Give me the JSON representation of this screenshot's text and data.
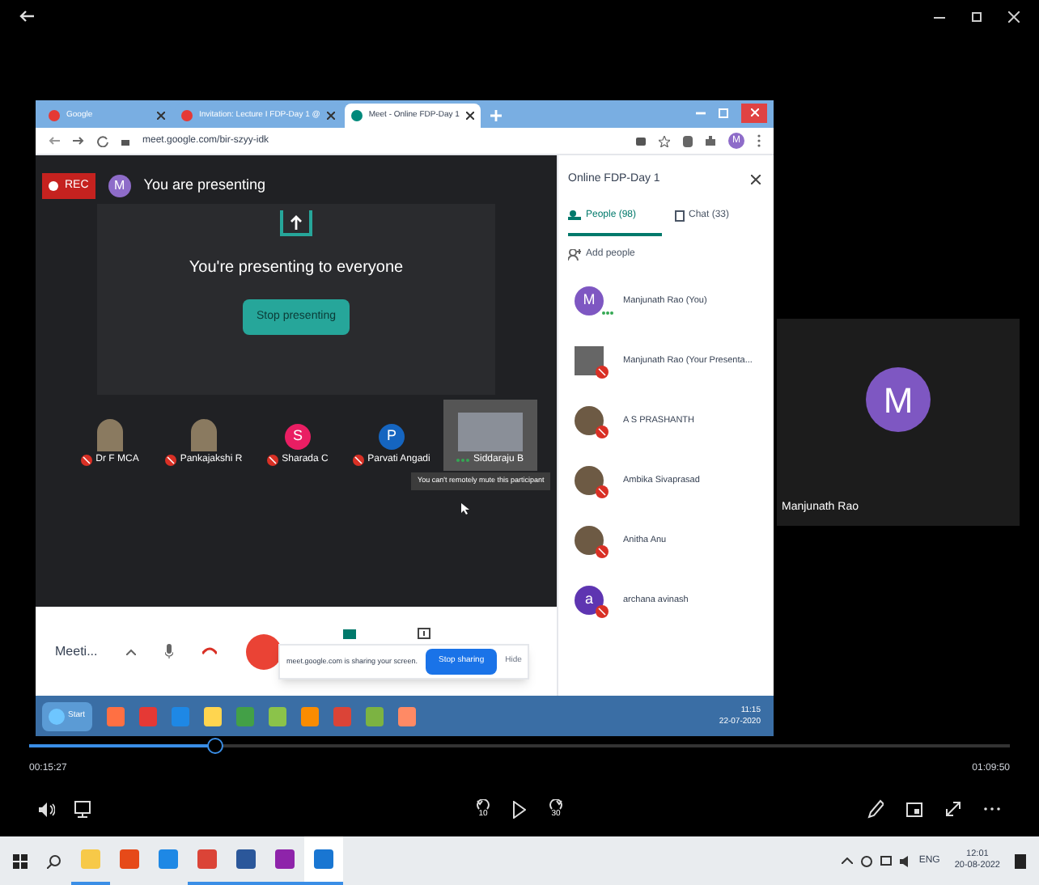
{
  "browser": {
    "tabs": [
      {
        "title": "Google",
        "selected": false
      },
      {
        "title": "Invitation: Lecture I FDP-Day 1 @",
        "selected": false
      },
      {
        "title": "Meet - Online FDP-Day 1",
        "selected": true
      }
    ],
    "url": "meet.google.com/bir-szyy-idk",
    "profile_initial": "M"
  },
  "meeting": {
    "rec_label": "REC",
    "presenter_initial": "M",
    "presenting_status": "You are presenting",
    "presenting_message": "You're presenting to everyone",
    "stop_presenting": "Stop presenting",
    "participants": [
      {
        "name": "Dr F MCA",
        "kind": "photo",
        "muted": true
      },
      {
        "name": "Pankajakshi R",
        "kind": "photo",
        "muted": true
      },
      {
        "name": "Sharada C",
        "kind": "letter",
        "initial": "S",
        "color": "#e91e63",
        "muted": true
      },
      {
        "name": "Parvati Angadi",
        "kind": "letter",
        "initial": "P",
        "color": "#1565c0",
        "muted": true
      },
      {
        "name": "Siddaraju B",
        "kind": "video",
        "muted": false
      }
    ],
    "tooltip": "You can't remotely mute this participant",
    "meeting_name": "Meeti...",
    "share_bar": {
      "message": "meet.google.com is sharing your screen.",
      "stop": "Stop sharing",
      "hide": "Hide"
    }
  },
  "side_panel": {
    "title": "Online FDP-Day 1",
    "tabs": [
      {
        "label": "People (98)",
        "selected": true
      },
      {
        "label": "Chat (33)",
        "selected": false
      }
    ],
    "add_people": "Add people",
    "people": [
      {
        "name": "Manjunath Rao (You)",
        "kind": "letter",
        "initial": "M",
        "color": "#7e57c2",
        "muted": false
      },
      {
        "name": "Manjunath Rao (Your Presenta...",
        "kind": "screen",
        "muted": true
      },
      {
        "name": "A S PRASHANTH",
        "kind": "photo",
        "muted": true
      },
      {
        "name": "Ambika Sivaprasad",
        "kind": "photo",
        "muted": true
      },
      {
        "name": "Anitha Anu",
        "kind": "photo",
        "muted": true
      },
      {
        "name": "archana avinash",
        "kind": "letter",
        "initial": "a",
        "color": "#5e35b1",
        "muted": true
      }
    ]
  },
  "recorded_taskbar": {
    "start": "Start",
    "time": "11:15",
    "date": "22-07-2020"
  },
  "tile": {
    "initial": "M",
    "name": "Manjunath Rao"
  },
  "player": {
    "level": 0.19,
    "elapsed": "00:15:27",
    "total": "01:09:50",
    "rewind": "10",
    "forward": "30"
  },
  "taskbar": {
    "apps": [
      {
        "kind": "explorer",
        "running": true,
        "selected": false
      },
      {
        "kind": "office",
        "running": false,
        "selected": false
      },
      {
        "kind": "mail",
        "running": false,
        "selected": false
      },
      {
        "kind": "chrome",
        "running": true,
        "selected": false
      },
      {
        "kind": "word",
        "running": true,
        "selected": false
      },
      {
        "kind": "winrar",
        "running": true,
        "selected": false
      },
      {
        "kind": "movies",
        "running": true,
        "selected": true
      }
    ],
    "lang": "ENG",
    "time": "12:01",
    "date": "20-08-2022"
  }
}
